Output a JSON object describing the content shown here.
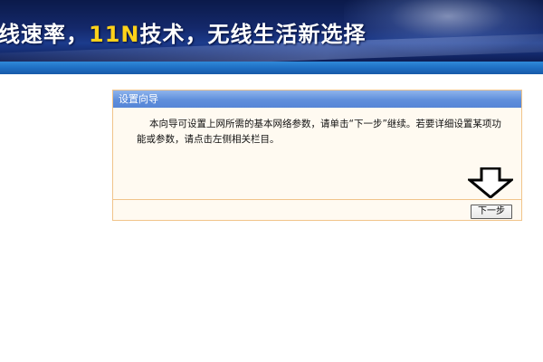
{
  "banner": {
    "slogan_prefix": "线速率，",
    "slogan_highlight": "11N",
    "slogan_suffix": "技术，无线生活新选择"
  },
  "wizard": {
    "title": "设置向导",
    "intro": "本向导可设置上网所需的基本网络参数，请单击“下一步”继续。若要详细设置某项功能或参数，请点击左侧相关栏目。",
    "next_label": "下一步",
    "arrow_icon": "arrow-down-icon"
  },
  "colors": {
    "banner_dark": "#0b1a4a",
    "stripe_blue": "#1f6fc4",
    "header_blue": "#5f8fdc",
    "panel_border": "#f1c48a",
    "highlight_yellow": "#ffd21a"
  }
}
